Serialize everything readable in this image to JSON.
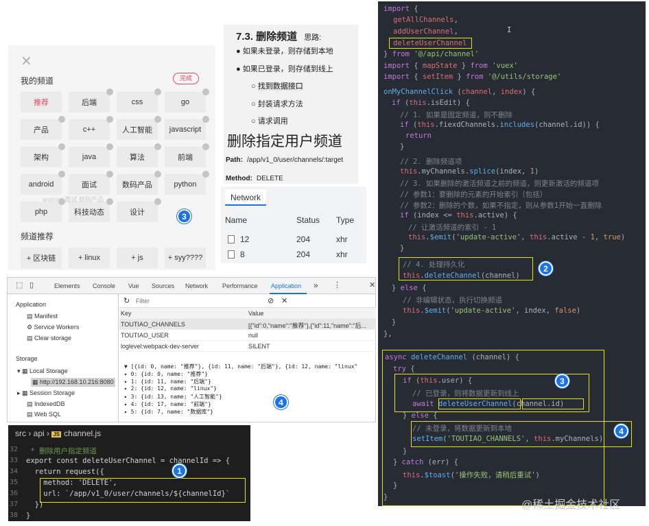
{
  "panel": {
    "close": "×",
    "my_channels_title": "我的频道",
    "done_label": "完成",
    "channels": [
      {
        "label": "推荐",
        "active": true
      },
      {
        "label": "后端"
      },
      {
        "label": "css"
      },
      {
        "label": "go"
      },
      {
        "label": "产品"
      },
      {
        "label": "c++"
      },
      {
        "label": "人工智能"
      },
      {
        "label": "javascript"
      },
      {
        "label": "架构"
      },
      {
        "label": "java"
      },
      {
        "label": "算法"
      },
      {
        "label": "前端"
      },
      {
        "label": "android"
      },
      {
        "label": "面试"
      },
      {
        "label": "数码产品"
      },
      {
        "label": "python"
      },
      {
        "label": "php"
      },
      {
        "label": "科技动态"
      },
      {
        "label": "设计"
      }
    ],
    "ghost_text": "android 面试 数码产品",
    "recommend_title": "频道推荐",
    "recommend": [
      "+ 区块链",
      "+ linux",
      "+ js",
      "+ syy????"
    ],
    "badge": "3"
  },
  "notes": {
    "title": "7.3. 删除频道",
    "title_aside": "思路:",
    "items": [
      "如果未登录，则存储到本地",
      "如果已登录，则存储到线上"
    ],
    "subitems": [
      "找到数据接口",
      "封装请求方法",
      "请求调用"
    ],
    "heading": "删除指定用户频道",
    "path_label": "Path:",
    "path_value": "/app/v1_0/user/channels/:target",
    "method_label": "Method:",
    "method_value": "DELETE"
  },
  "network": {
    "tab": "Network",
    "columns": [
      "Name",
      "Status",
      "Type"
    ],
    "rows": [
      {
        "name": "12",
        "status": "204",
        "type": "xhr"
      },
      {
        "name": "8",
        "status": "204",
        "type": "xhr"
      }
    ]
  },
  "devtools": {
    "tabs": [
      "Elements",
      "Console",
      "Vue",
      "Sources",
      "Network",
      "Performance",
      "Application"
    ],
    "more": "»",
    "side": {
      "application": "Application",
      "manifest": "Manifest",
      "service_workers": "Service Workers",
      "clear_storage": "Clear storage",
      "storage": "Storage",
      "local_storage": "Local Storage",
      "local_origin": "http://192.168.10.216:8080",
      "session_storage": "Session Storage",
      "indexeddb": "IndexedDB",
      "websql": "Web SQL"
    },
    "filter_placeholder": "Filter",
    "key_header": "Key",
    "value_header": "Value",
    "rows": [
      {
        "key": "TOUTIAO_CHANNELS",
        "value": "[{\"id\":0,\"name\":\"推荐\"},{\"id\":11,\"name\":\"后..."
      },
      {
        "key": "TOUTIAO_USER",
        "value": "null"
      },
      {
        "key": "loglevel:webpack-dev-server",
        "value": "SILENT"
      }
    ],
    "json_lines": [
      "▼ [{id: 0, name: \"推荐\"}, {id: 11, name: \"后端\"}, {id: 12, name: \"linux\"",
      "  ▸ 0: {id: 0, name: \"推荐\"}",
      "  ▸ 1: {id: 11, name: \"后端\"}",
      "  ▸ 2: {id: 12, name: \"linux\"}",
      "  ▸ 3: {id: 13, name: \"人工智能\"}",
      "  ▸ 4: {id: 17, name: \"前端\"}",
      "  ▸ 5: {id: 7, name: \"数据库\"}"
    ],
    "badge": "4"
  },
  "vscode": {
    "breadcrumb": [
      "src",
      "api",
      "channel.js"
    ],
    "js_label": "JS",
    "line_numbers": [
      "32",
      "33",
      "34",
      "35",
      "36",
      "37",
      "38"
    ],
    "lines": [
      " * 删除用户指定频道",
      "export const deleteUserChannel = channelId => {",
      "  return request({",
      "    method: 'DELETE',",
      "    url: `/app/v1_0/user/channels/${channelId}`",
      "  })",
      "}"
    ],
    "badge": "1"
  },
  "editor": {
    "badges": [
      "2",
      "3",
      "4"
    ],
    "watermark": "@稀土掘金技术社区"
  }
}
